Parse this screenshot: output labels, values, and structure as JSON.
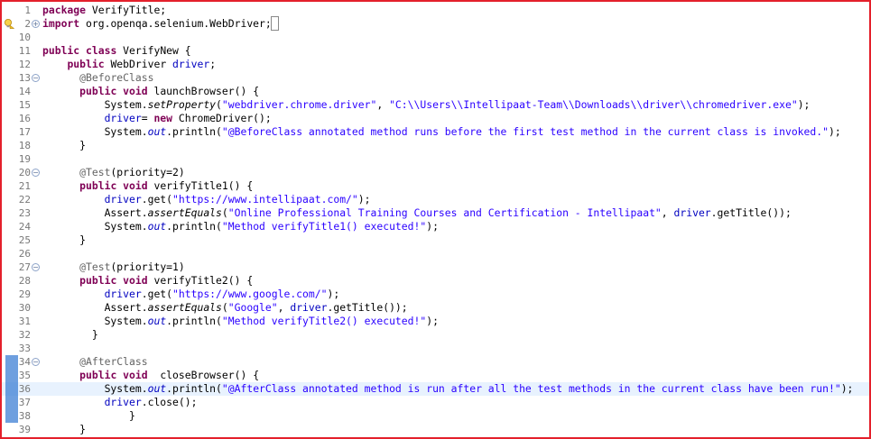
{
  "editor": {
    "lines": [
      {
        "n": "1",
        "tokens": [
          {
            "t": "package",
            "c": "k"
          },
          {
            "t": " VerifyTitle;"
          }
        ]
      },
      {
        "n": "2",
        "fold": "plus",
        "marker": "warning",
        "tokens": [
          {
            "t": "import",
            "c": "k"
          },
          {
            "t": " org.openqa.selenium.WebDriver;"
          },
          {
            "t": " ",
            "c": "cur"
          }
        ]
      },
      {
        "n": "10",
        "tokens": []
      },
      {
        "n": "11",
        "tokens": [
          {
            "t": "public",
            "c": "k"
          },
          {
            "t": " "
          },
          {
            "t": "class",
            "c": "k"
          },
          {
            "t": " VerifyNew {"
          }
        ]
      },
      {
        "n": "12",
        "tokens": [
          {
            "t": "    "
          },
          {
            "t": "public",
            "c": "k"
          },
          {
            "t": " WebDriver "
          },
          {
            "t": "driver",
            "c": "f"
          },
          {
            "t": ";"
          }
        ]
      },
      {
        "n": "13",
        "fold": "minus",
        "tokens": [
          {
            "t": "      "
          },
          {
            "t": "@BeforeClass",
            "c": "a"
          }
        ]
      },
      {
        "n": "14",
        "tokens": [
          {
            "t": "      "
          },
          {
            "t": "public",
            "c": "k"
          },
          {
            "t": " "
          },
          {
            "t": "void",
            "c": "k"
          },
          {
            "t": " launchBrowser() {"
          }
        ]
      },
      {
        "n": "15",
        "tokens": [
          {
            "t": "          System."
          },
          {
            "t": "setProperty",
            "c": "it"
          },
          {
            "t": "("
          },
          {
            "t": "\"webdriver.chrome.driver\"",
            "c": "s"
          },
          {
            "t": ", "
          },
          {
            "t": "\"C:\\\\Users\\\\Intellipaat-Team\\\\Downloads\\\\driver\\\\chromedriver.exe\"",
            "c": "s"
          },
          {
            "t": ");"
          }
        ]
      },
      {
        "n": "16",
        "tokens": [
          {
            "t": "          "
          },
          {
            "t": "driver",
            "c": "f"
          },
          {
            "t": "= "
          },
          {
            "t": "new",
            "c": "k"
          },
          {
            "t": " ChromeDriver();"
          }
        ]
      },
      {
        "n": "17",
        "tokens": [
          {
            "t": "          System."
          },
          {
            "t": "out",
            "c": "sf"
          },
          {
            "t": ".println("
          },
          {
            "t": "\"@BeforeClass annotated method runs before the first test method in the current class is invoked.\"",
            "c": "s"
          },
          {
            "t": ");"
          }
        ]
      },
      {
        "n": "18",
        "tokens": [
          {
            "t": "      }"
          }
        ]
      },
      {
        "n": "19",
        "tokens": []
      },
      {
        "n": "20",
        "fold": "minus",
        "tokens": [
          {
            "t": "      "
          },
          {
            "t": "@Test",
            "c": "a"
          },
          {
            "t": "(priority=2)"
          }
        ]
      },
      {
        "n": "21",
        "tokens": [
          {
            "t": "      "
          },
          {
            "t": "public",
            "c": "k"
          },
          {
            "t": " "
          },
          {
            "t": "void",
            "c": "k"
          },
          {
            "t": " verifyTitle1() {"
          }
        ]
      },
      {
        "n": "22",
        "tokens": [
          {
            "t": "          "
          },
          {
            "t": "driver",
            "c": "f"
          },
          {
            "t": ".get("
          },
          {
            "t": "\"https://www.intellipaat.com/\"",
            "c": "s"
          },
          {
            "t": ");"
          }
        ]
      },
      {
        "n": "23",
        "tokens": [
          {
            "t": "          Assert."
          },
          {
            "t": "assertEquals",
            "c": "it"
          },
          {
            "t": "("
          },
          {
            "t": "\"Online Professional Training Courses and Certification - Intellipaat\"",
            "c": "s"
          },
          {
            "t": ", "
          },
          {
            "t": "driver",
            "c": "f"
          },
          {
            "t": ".getTitle());"
          }
        ]
      },
      {
        "n": "24",
        "tokens": [
          {
            "t": "          System."
          },
          {
            "t": "out",
            "c": "sf"
          },
          {
            "t": ".println("
          },
          {
            "t": "\"Method verifyTitle1() executed!\"",
            "c": "s"
          },
          {
            "t": ");"
          }
        ]
      },
      {
        "n": "25",
        "tokens": [
          {
            "t": "      }"
          }
        ]
      },
      {
        "n": "26",
        "tokens": []
      },
      {
        "n": "27",
        "fold": "minus",
        "tokens": [
          {
            "t": "      "
          },
          {
            "t": "@Test",
            "c": "a"
          },
          {
            "t": "(priority=1)"
          }
        ]
      },
      {
        "n": "28",
        "tokens": [
          {
            "t": "      "
          },
          {
            "t": "public",
            "c": "k"
          },
          {
            "t": " "
          },
          {
            "t": "void",
            "c": "k"
          },
          {
            "t": " verifyTitle2() {"
          }
        ]
      },
      {
        "n": "29",
        "tokens": [
          {
            "t": "          "
          },
          {
            "t": "driver",
            "c": "f"
          },
          {
            "t": ".get("
          },
          {
            "t": "\"https://www.google.com/\"",
            "c": "s"
          },
          {
            "t": ");"
          }
        ]
      },
      {
        "n": "30",
        "tokens": [
          {
            "t": "          Assert."
          },
          {
            "t": "assertEquals",
            "c": "it"
          },
          {
            "t": "("
          },
          {
            "t": "\"Google\"",
            "c": "s"
          },
          {
            "t": ", "
          },
          {
            "t": "driver",
            "c": "f"
          },
          {
            "t": ".getTitle());"
          }
        ]
      },
      {
        "n": "31",
        "tokens": [
          {
            "t": "          System."
          },
          {
            "t": "out",
            "c": "sf"
          },
          {
            "t": ".println("
          },
          {
            "t": "\"Method verifyTitle2() executed!\"",
            "c": "s"
          },
          {
            "t": ");"
          }
        ]
      },
      {
        "n": "32",
        "tokens": [
          {
            "t": "        }"
          }
        ]
      },
      {
        "n": "33",
        "tokens": []
      },
      {
        "n": "34",
        "fold": "minus",
        "change": true,
        "tokens": [
          {
            "t": "      "
          },
          {
            "t": "@AfterClass",
            "c": "a"
          }
        ]
      },
      {
        "n": "35",
        "change": true,
        "tokens": [
          {
            "t": "      "
          },
          {
            "t": "public",
            "c": "k"
          },
          {
            "t": " "
          },
          {
            "t": "void",
            "c": "k"
          },
          {
            "t": "  closeBrowser() {"
          }
        ]
      },
      {
        "n": "36",
        "change": true,
        "highlight": true,
        "tokens": [
          {
            "t": "          System."
          },
          {
            "t": "out",
            "c": "sf"
          },
          {
            "t": ".println("
          },
          {
            "t": "\"@AfterClass annotated method is run after all the test methods in the current class have been run!\"",
            "c": "s"
          },
          {
            "t": ");"
          }
        ]
      },
      {
        "n": "37",
        "change": true,
        "tokens": [
          {
            "t": "          "
          },
          {
            "t": "driver",
            "c": "f"
          },
          {
            "t": ".close();"
          }
        ]
      },
      {
        "n": "38",
        "change": true,
        "tokens": [
          {
            "t": "              }"
          }
        ]
      },
      {
        "n": "39",
        "tokens": [
          {
            "t": "      }"
          }
        ]
      }
    ]
  },
  "colors": {
    "frame_border": "#e4202b",
    "keyword": "#7f0055",
    "string": "#2a00ff",
    "field": "#0000c0",
    "annotation": "#646464",
    "line_number": "#787878",
    "current_line": "#e8f2fe",
    "change_bar": "#3d7fd4"
  },
  "icons": {
    "marker_warning": "lightbulb-warning-icon",
    "fold_plus": "fold-expand-icon",
    "fold_minus": "fold-collapse-icon"
  }
}
